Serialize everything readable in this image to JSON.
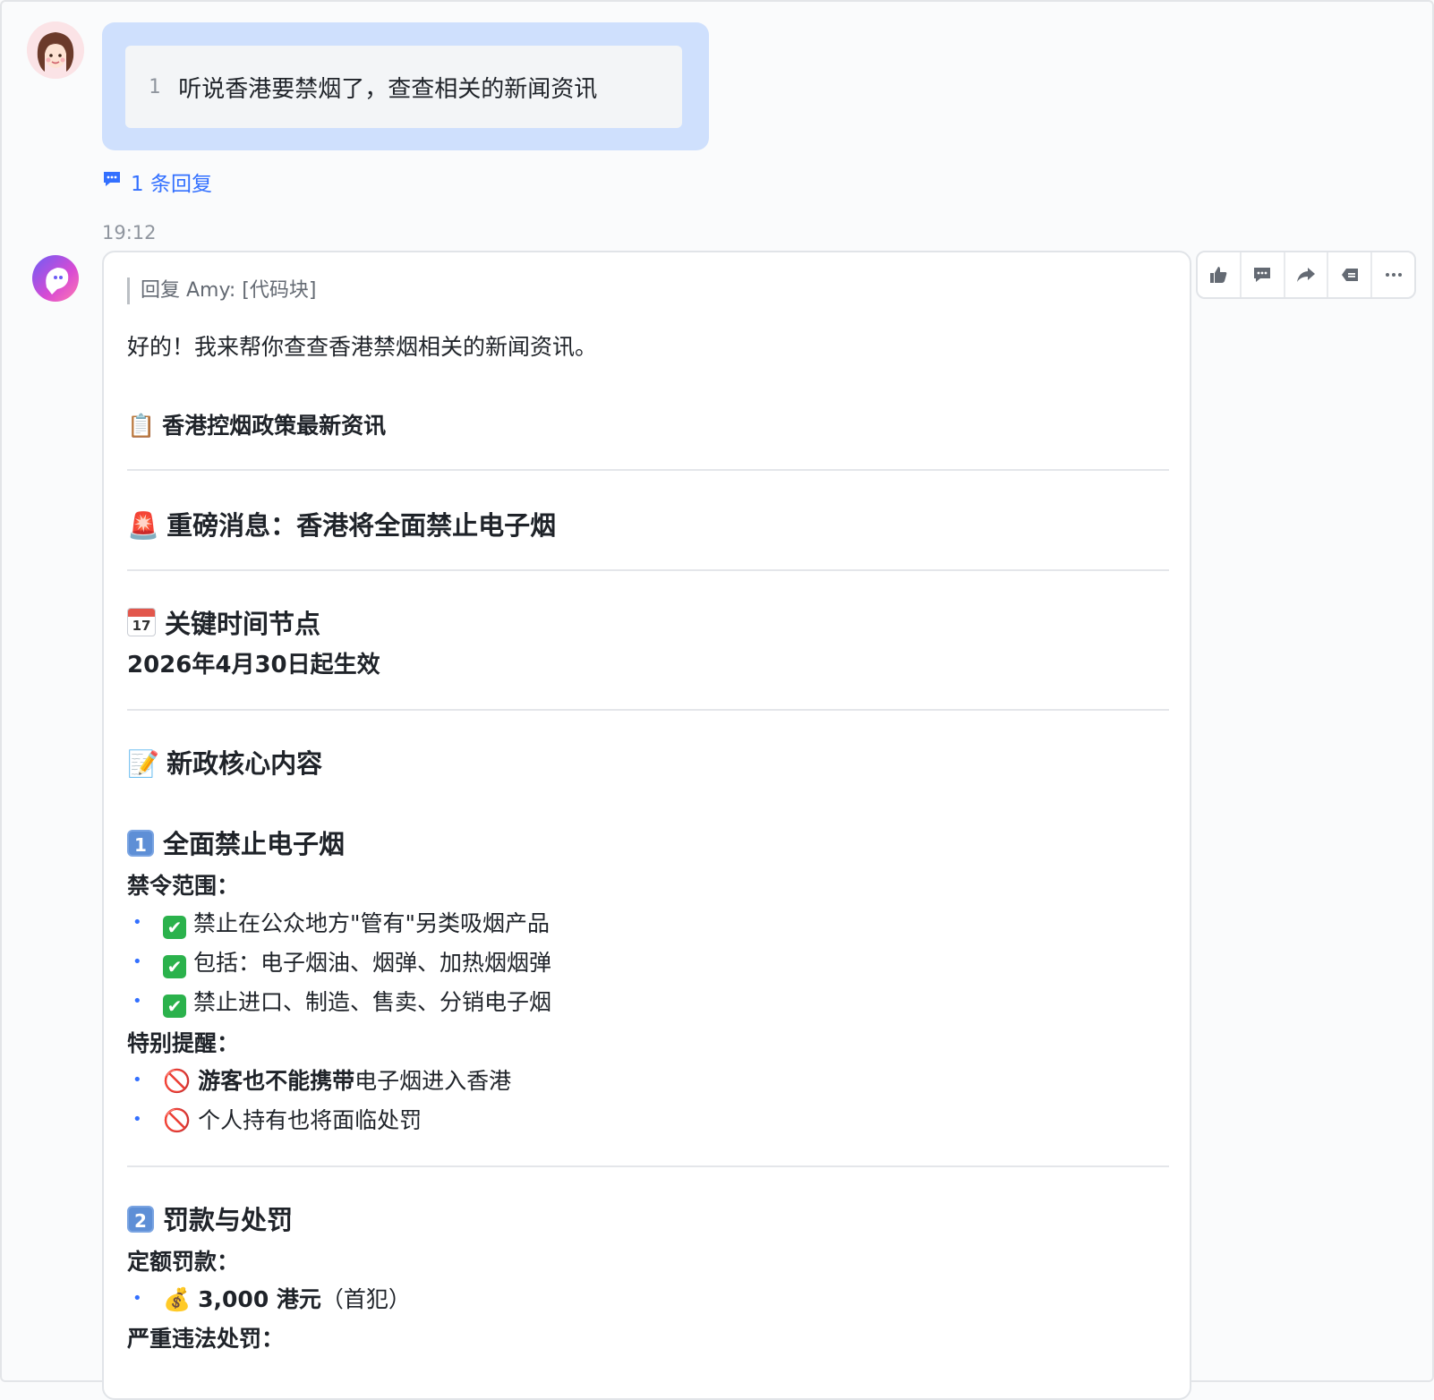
{
  "user_message": {
    "line_number": "1",
    "text": "听说香港要禁烟了，查查相关的新闻资讯",
    "reply_count_label": "1 条回复"
  },
  "timestamp": "19:12",
  "bot_reply": {
    "quote": "回复 Amy: [代码块]",
    "greeting": "好的！我来帮你查查香港禁烟相关的新闻资讯。",
    "headline": "香港控烟政策最新资讯",
    "breaking": "重磅消息：香港将全面禁止电子烟",
    "key_dates_title": "关键时间节点",
    "effective_date": "2026年4月30日起生效",
    "core_title": "新政核心内容",
    "section1": {
      "number": "1",
      "title": "全面禁止电子烟",
      "scope_label": "禁令范围：",
      "scope_items": [
        "禁止在公众地方\"管有\"另类吸烟产品",
        "包括：电子烟油、烟弹、加热烟烟弹",
        "禁止进口、制造、售卖、分销电子烟"
      ],
      "reminder_label": "特别提醒：",
      "reminder_item1_bold": "游客也不能携带",
      "reminder_item1_rest": "电子烟进入香港",
      "reminder_item2": "个人持有也将面临处罚"
    },
    "section2": {
      "number": "2",
      "title": "罚款与处罚",
      "fine_label": "定额罚款：",
      "fine_bold": "3,000 港元",
      "fine_rest": "（首犯）",
      "serious_label": "严重违法处罚："
    }
  },
  "icons": {
    "clipboard": "📋",
    "siren": "🚨",
    "memo": "📝",
    "money_bag": "💰",
    "prohibited": "🚫",
    "check_mark": "✔"
  },
  "colors": {
    "accent": "#3370ff",
    "user_bubble": "#cfe0fd",
    "check_green": "#2bb24c"
  }
}
